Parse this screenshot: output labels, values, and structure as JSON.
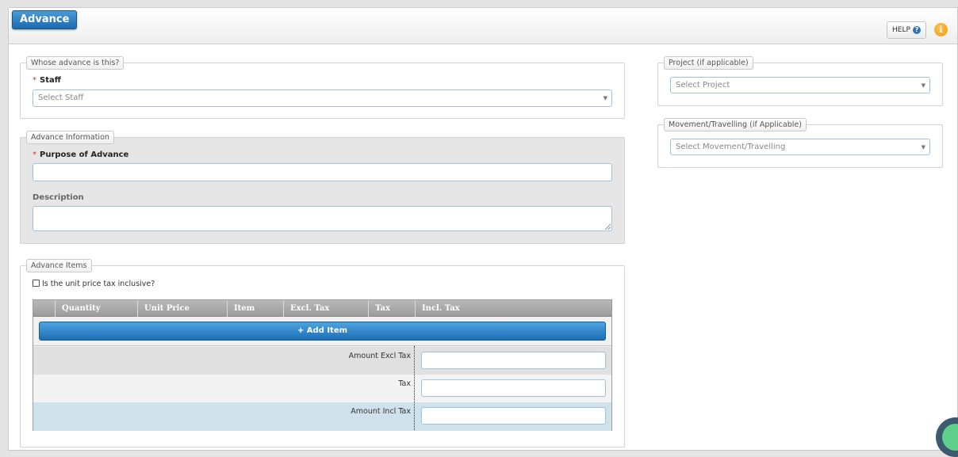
{
  "header": {
    "title": "Advance",
    "help_label": "HELP",
    "help_icon_glyph": "?",
    "info_icon_glyph": "i"
  },
  "whose": {
    "legend": "Whose advance is this?",
    "staff_label": "Staff",
    "required_mark": "*",
    "staff_placeholder": "Select Staff"
  },
  "advance_info": {
    "legend": "Advance Information",
    "purpose_label": "Purpose of Advance",
    "required_mark": "*",
    "purpose_value": "",
    "description_label": "Description",
    "description_value": ""
  },
  "items": {
    "legend": "Advance Items",
    "tax_inclusive_label": "Is the unit price tax inclusive?",
    "tax_inclusive_checked": false,
    "columns": [
      "",
      "Quantity",
      "Unit Price",
      "Item",
      "Excl. Tax",
      "Tax",
      "Incl. Tax"
    ],
    "add_item_label": "+ Add Item",
    "amount_excl_label": "Amount Excl Tax",
    "tax_label": "Tax",
    "amount_incl_label": "Amount Incl Tax"
  },
  "project": {
    "legend": "Project (if applicable)",
    "placeholder": "Select Project"
  },
  "movement": {
    "legend": "Movement/Travelling (if Applicable)",
    "placeholder": "Select Movement/Travelling"
  },
  "colors": {
    "accent": "#1c6aae",
    "required": "#d32f2f",
    "incl_row": "#cfe2ec"
  }
}
